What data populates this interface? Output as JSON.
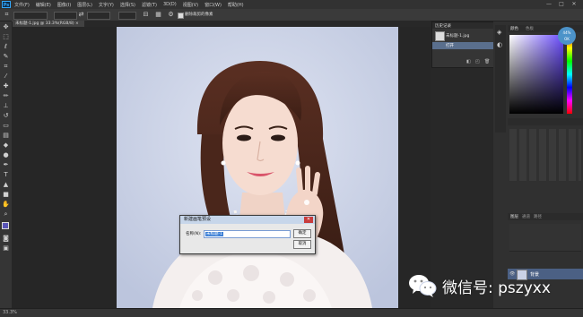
{
  "app": {
    "logo_text": "Ps"
  },
  "menu": {
    "items": [
      "文件(F)",
      "编辑(E)",
      "图像(I)",
      "图层(L)",
      "文字(Y)",
      "选择(S)",
      "滤镜(T)",
      "3D(D)",
      "视图(V)",
      "窗口(W)",
      "帮助(H)"
    ]
  },
  "window_controls": {
    "minimize": "—",
    "maximize": "□",
    "close": "✕"
  },
  "options_bar": {
    "checkbox_label": "删除裁剪的像素"
  },
  "document": {
    "tab_title": "未标题-1.jpg @ 33.3%(RGB/8) ×"
  },
  "history_panel": {
    "tab": "历史记录",
    "snapshot_label": "未标题-1.jpg",
    "state_label": "打开"
  },
  "color_panel": {
    "tabs": [
      "颜色",
      "色板"
    ]
  },
  "layers_panel": {
    "tabs": [
      "图层",
      "通道",
      "路径"
    ],
    "layer_name": "背景"
  },
  "badge": {
    "line1": "44%",
    "line2": "OK"
  },
  "status_bar": {
    "zoom": "33.3%"
  },
  "dialog": {
    "title": "新建画笔预设",
    "name_label": "名称(N):",
    "name_value": "未标题-1",
    "ok_label": "确定",
    "cancel_label": "取消",
    "close_glyph": "✕"
  },
  "watermark": {
    "text": "微信号: pszyxx"
  },
  "colors": {
    "accent": "#31a8ff",
    "dialog_title_bg": "#c7d6ea",
    "close_red": "#c83c3c",
    "photo_bg": "#c9d1e6"
  }
}
